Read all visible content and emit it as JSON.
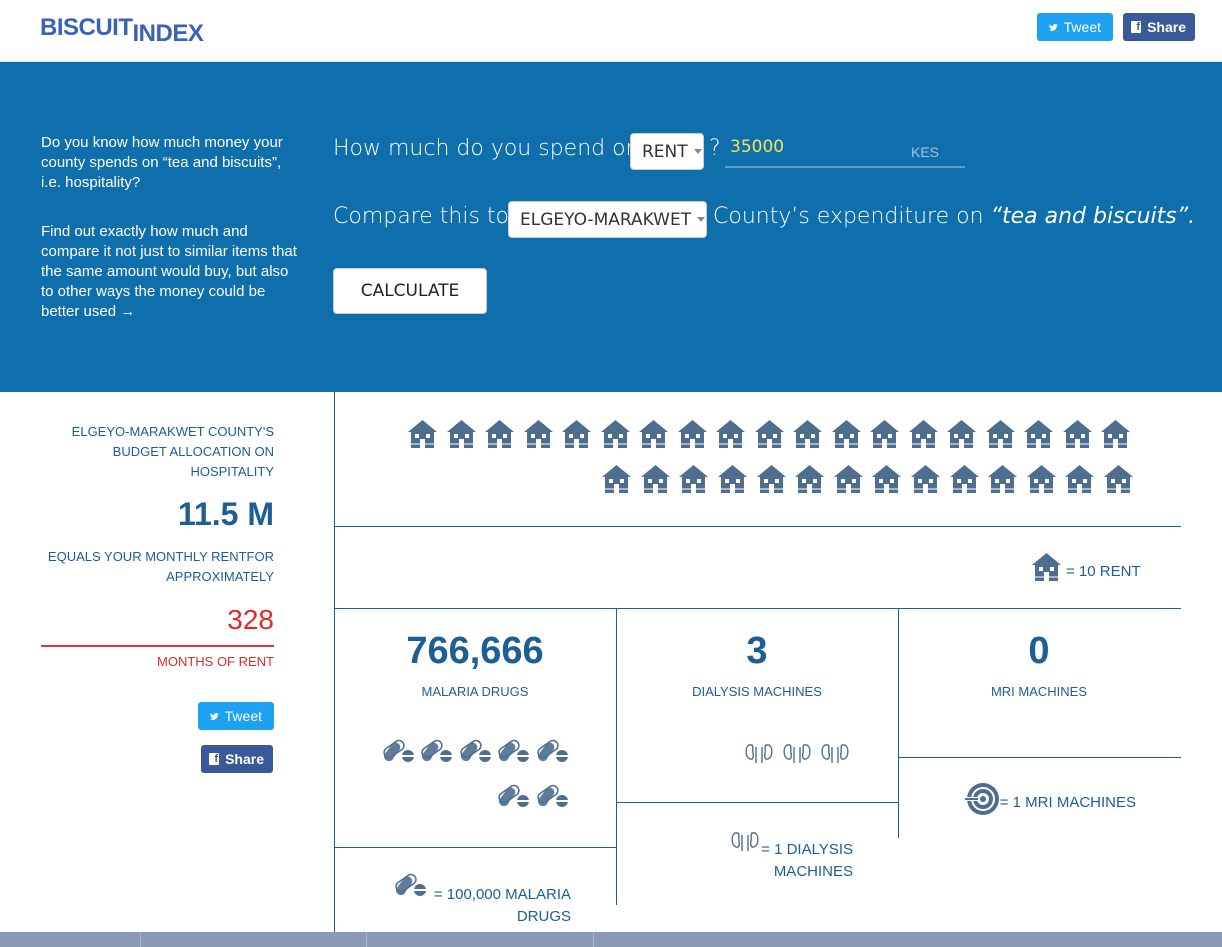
{
  "header": {
    "logo_part1": "BISCUIT",
    "logo_part2": "INDEX",
    "tweet_label": "Tweet",
    "share_label": "Share"
  },
  "hero": {
    "intro_1": "Do you know how much money your county spends on “tea and biscuits”, i.e. hospitality?",
    "intro_2": "Find out exactly how much and compare it not just to similar items that the same amount would buy, but also to other ways the money could be better used →",
    "question_prefix": "How much do you spend on",
    "spend_item": "RENT",
    "question_mark": "?",
    "amount": "35000",
    "currency": "KES",
    "compare_prefix": "Compare this to",
    "county": "ELGEYO-MARAKWET",
    "compare_suffix": "County’s expenditure on",
    "compare_item": "“tea and biscuits”.",
    "calculate_label": "CALCULATE"
  },
  "summary": {
    "allocation_label": "ELGEYO-MARAKWET COUNTY'S BUDGET ALLOCATION ON HOSPITALITY",
    "allocation_value": "11.5 M",
    "equals_label": "EQUALS YOUR MONTHLY RENTFOR APPROXIMATELY",
    "months_value": "328",
    "months_label": "MONTHS OF RENT",
    "tweet_label": "Tweet",
    "share_label": "Share"
  },
  "rent_icons": {
    "count": 33,
    "legend": "= 10 RENT",
    "icon": "house-icon"
  },
  "comparisons": [
    {
      "value": "766,666",
      "label": "MALARIA DRUGS",
      "icons": 7,
      "legend": "= 100,000 MALARIA DRUGS",
      "icon": "pill-icon"
    },
    {
      "value": "3",
      "label": "DIALYSIS MACHINES",
      "icons": 3,
      "legend": "= 1 DIALYSIS MACHINES",
      "icon": "kidney-icon"
    },
    {
      "value": "0",
      "label": "MRI MACHINES",
      "icons": 0,
      "legend": "= 1 MRI MACHINES",
      "icon": "mri-icon"
    }
  ],
  "colors": {
    "primary": "#1c5e95",
    "hero": "#0f6fac",
    "accent_red": "#e02a2a",
    "amount": "#f4e35a",
    "twitter": "#1da1f2",
    "facebook": "#3b5998",
    "icon": "#4f6e8f"
  }
}
